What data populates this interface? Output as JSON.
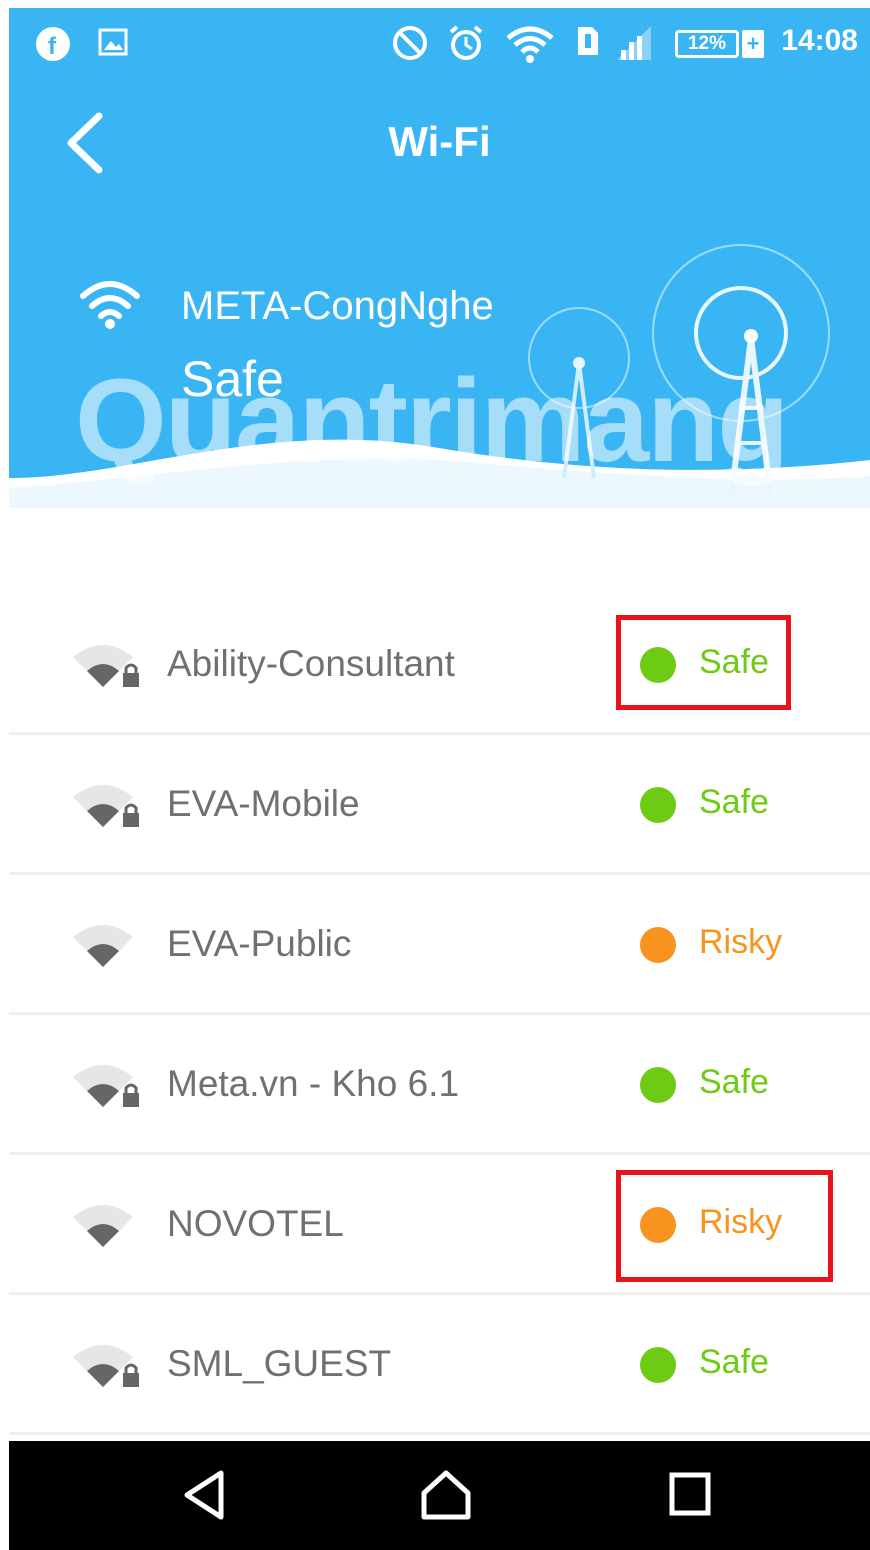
{
  "status_bar": {
    "battery": "12%",
    "time": "14:08"
  },
  "header": {
    "title": "Wi-Fi",
    "current_network": {
      "ssid": "META-CongNghe",
      "status": "Safe"
    },
    "watermark": "Quantrimang"
  },
  "colors": {
    "header_bg": "#3ab5f4",
    "safe": "#6ecb14",
    "risky": "#f7931e",
    "highlight_border": "#e8141a"
  },
  "networks": [
    {
      "name": "Ability-Consultant",
      "status": "Safe",
      "locked": true
    },
    {
      "name": "EVA-Mobile",
      "status": "Safe",
      "locked": true
    },
    {
      "name": "EVA-Public",
      "status": "Risky",
      "locked": false
    },
    {
      "name": "Meta.vn - Kho 6.1",
      "status": "Safe",
      "locked": true
    },
    {
      "name": "NOVOTEL",
      "status": "Risky",
      "locked": false
    },
    {
      "name": "SML_GUEST",
      "status": "Safe",
      "locked": true
    }
  ],
  "icons": {
    "back": "chevron-left-icon",
    "nav_back": "triangle-back-icon",
    "nav_home": "home-icon",
    "nav_recents": "square-recents-icon"
  }
}
